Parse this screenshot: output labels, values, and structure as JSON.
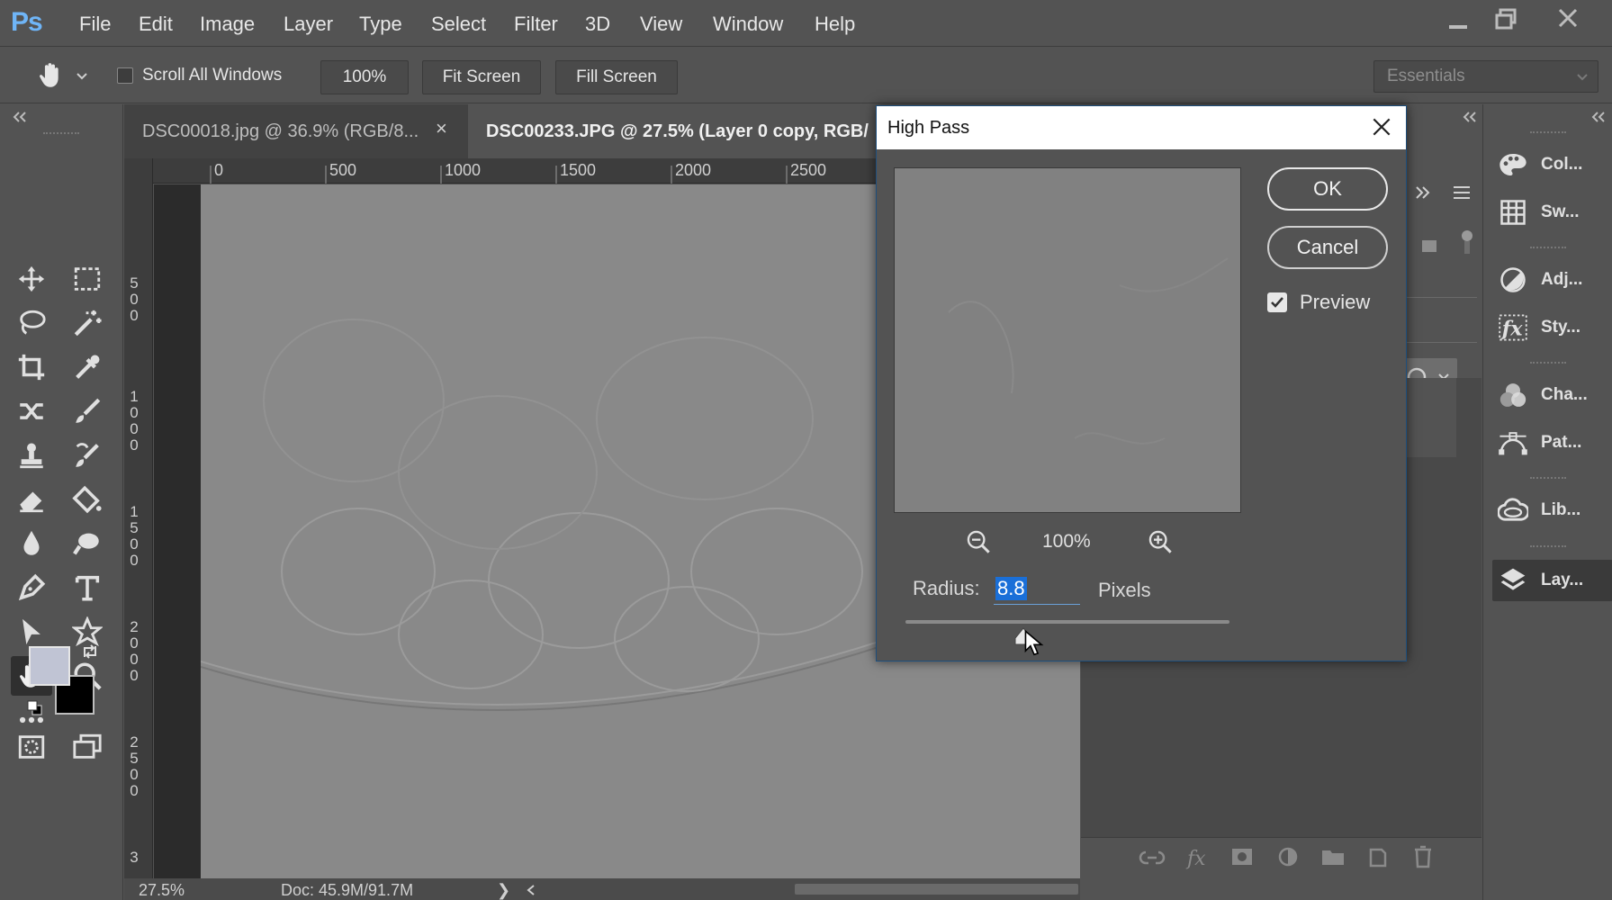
{
  "app": {
    "logo": "Ps",
    "menu": [
      "File",
      "Edit",
      "Image",
      "Layer",
      "Type",
      "Select",
      "Filter",
      "3D",
      "View",
      "Window",
      "Help"
    ]
  },
  "window_controls": [
    "minimize-icon",
    "restore-icon",
    "close-icon"
  ],
  "options_bar": {
    "scroll_all_windows_label": "Scroll All Windows",
    "scroll_all_windows_checked": false,
    "zoom_value": "100%",
    "fit_screen_label": "Fit Screen",
    "fill_screen_label": "Fill Screen",
    "workspace_value": "Essentials"
  },
  "tabs": [
    {
      "label": "DSC00018.jpg @ 36.9% (RGB/8...",
      "active": false
    },
    {
      "label": "DSC00233.JPG @ 27.5% (Layer 0 copy, RGB/",
      "active": true
    }
  ],
  "ruler": {
    "top_labels": [
      "0",
      "500",
      "1000",
      "1500",
      "2000",
      "2500"
    ],
    "left_labels": [
      "500",
      "1000",
      "1500",
      "2000",
      "2500",
      "3"
    ]
  },
  "status": {
    "zoom": "27.5%",
    "doc": "Doc: 45.9M/91.7M",
    "arrow": "❯"
  },
  "right_panels": [
    {
      "label": "Col...",
      "icon": "palette-icon"
    },
    {
      "label": "Sw...",
      "icon": "swatches-icon"
    },
    {
      "label": "Adj...",
      "icon": "adjustments-icon"
    },
    {
      "label": "Sty...",
      "icon": "fx-styles-icon"
    },
    {
      "label": "Cha...",
      "icon": "channels-icon"
    },
    {
      "label": "Pat...",
      "icon": "paths-icon"
    },
    {
      "label": "Lib...",
      "icon": "libraries-icon"
    },
    {
      "label": "Lay...",
      "icon": "layers-icon",
      "active": true
    }
  ],
  "dialog": {
    "title": "High Pass",
    "ok_label": "OK",
    "cancel_label": "Cancel",
    "preview_label": "Preview",
    "preview_checked": true,
    "zoom_level": "100%",
    "radius_label": "Radius:",
    "radius_value": "8.8",
    "radius_unit": "Pixels"
  },
  "colors": {
    "accent": "#1a6fd8",
    "foreground_swatch": "#c0c4d4",
    "background_swatch": "#000000",
    "ps_blue": "#6fb5f7"
  }
}
